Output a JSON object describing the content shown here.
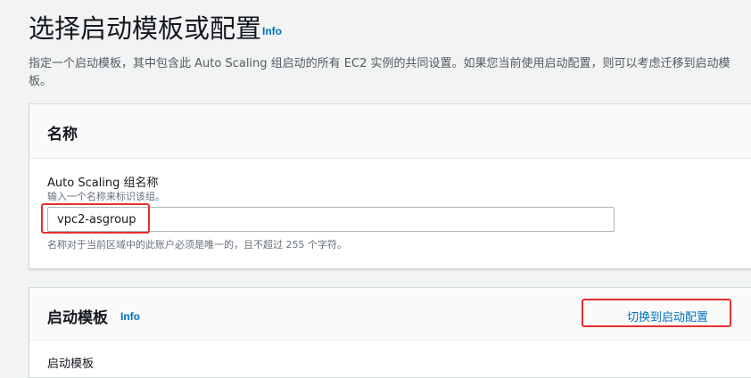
{
  "header": {
    "title": "选择启动模板或配置",
    "info_label": "Info",
    "description": "指定一个启动模板，其中包含此 Auto Scaling 组启动的所有 EC2 实例的共同设置。如果您当前使用启动配置，则可以考虑迁移到启动模板。"
  },
  "name_panel": {
    "heading": "名称",
    "field_label": "Auto Scaling 组名称",
    "field_hint": "输入一个名称来标识该组。",
    "field_value": "vpc2-asgroup",
    "field_constraint": "名称对于当前区域中的此账户必须是唯一的，且不超过 255 个字符。"
  },
  "launch_template_panel": {
    "heading": "启动模板",
    "info_label": "Info",
    "switch_link": "切换到启动配置",
    "partial_label": "启动模板"
  },
  "colors": {
    "accent_link": "#0073bb",
    "highlight": "#e3302f",
    "panel_header_bg": "#fafafa",
    "page_bg": "#f2f3f3"
  }
}
